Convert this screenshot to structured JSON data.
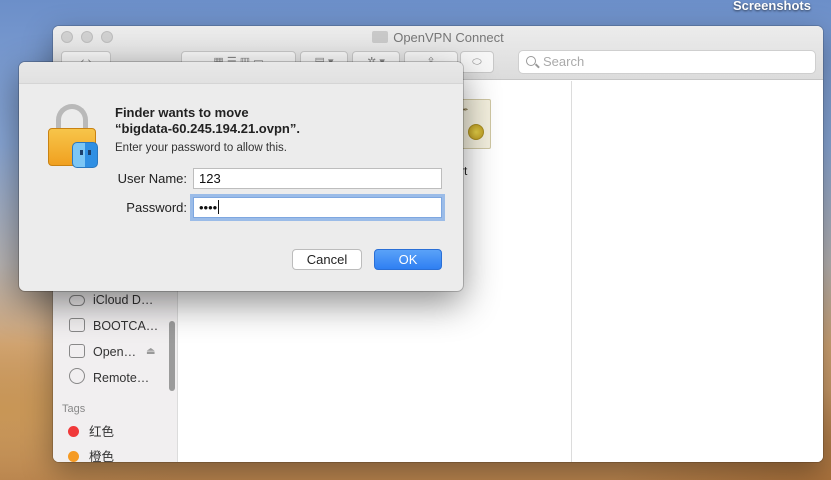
{
  "desktop": {
    "label": "Screenshots"
  },
  "finder": {
    "title": "OpenVPN Connect",
    "search_placeholder": "Search",
    "sidebar": {
      "items": [
        {
          "label": "iCloud D…",
          "icon": "cloud-icon"
        },
        {
          "label": "BOOTCA…",
          "icon": "disk-icon"
        },
        {
          "label": "Open…",
          "icon": "drive-icon",
          "eject": "⏏"
        },
        {
          "label": "Remote…",
          "icon": "disc-icon"
        }
      ],
      "tags_header": "Tags",
      "tags": [
        {
          "label": "红色",
          "color": "#f0393a"
        },
        {
          "label": "橙色",
          "color": "#f59a23"
        }
      ]
    },
    "file": {
      "label": "crt",
      "icon": "certificate-icon"
    }
  },
  "dialog": {
    "title_line1": "Finder wants to move",
    "title_line2": "“bigdata-60.245.194.21.ovpn”.",
    "subtitle": "Enter your password to allow this.",
    "username_label": "User Name:",
    "username_value": "123",
    "password_label": "Password:",
    "password_value": "••••",
    "cancel_label": "Cancel",
    "ok_label": "OK",
    "accent": "#2f7ff2"
  }
}
